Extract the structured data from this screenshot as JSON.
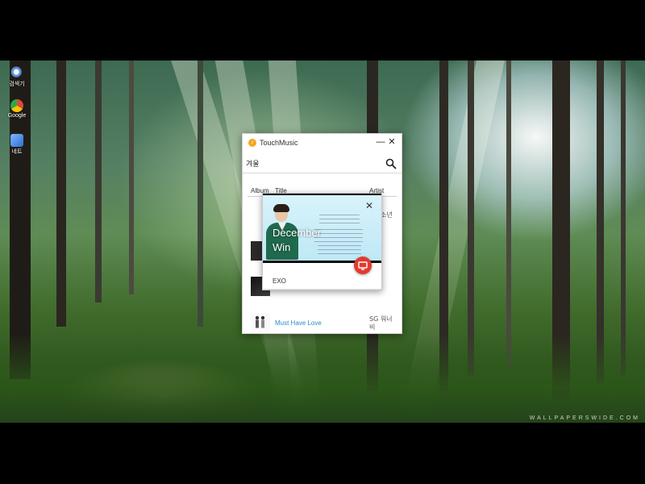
{
  "desktop": {
    "icons": [
      {
        "label": "검색기",
        "icon": "search-icon",
        "color": "#5a8fd8"
      },
      {
        "label": "Google",
        "icon": "chrome-icon",
        "color": "#dd4b39"
      },
      {
        "label": "네트",
        "icon": "network-icon",
        "color": "#3d86d8"
      }
    ],
    "watermark": "WALLPAPERSWIDE.COM"
  },
  "window": {
    "title": "TouchMusic",
    "minimize_label": "—",
    "close_label": "✕",
    "search": {
      "value": "겨울",
      "placeholder": ""
    },
    "columns": {
      "album": "Album",
      "title": "Title",
      "artist": "Artist"
    },
    "partial_artist": "소년",
    "rows": [
      {
        "title": "Must Have Love",
        "artist": "SG 워너비"
      }
    ]
  },
  "popup": {
    "close_label": "✕",
    "overlay_line1": "December",
    "overlay_line2": "Win",
    "artist": "EXO",
    "accent": "#e23b2e"
  }
}
